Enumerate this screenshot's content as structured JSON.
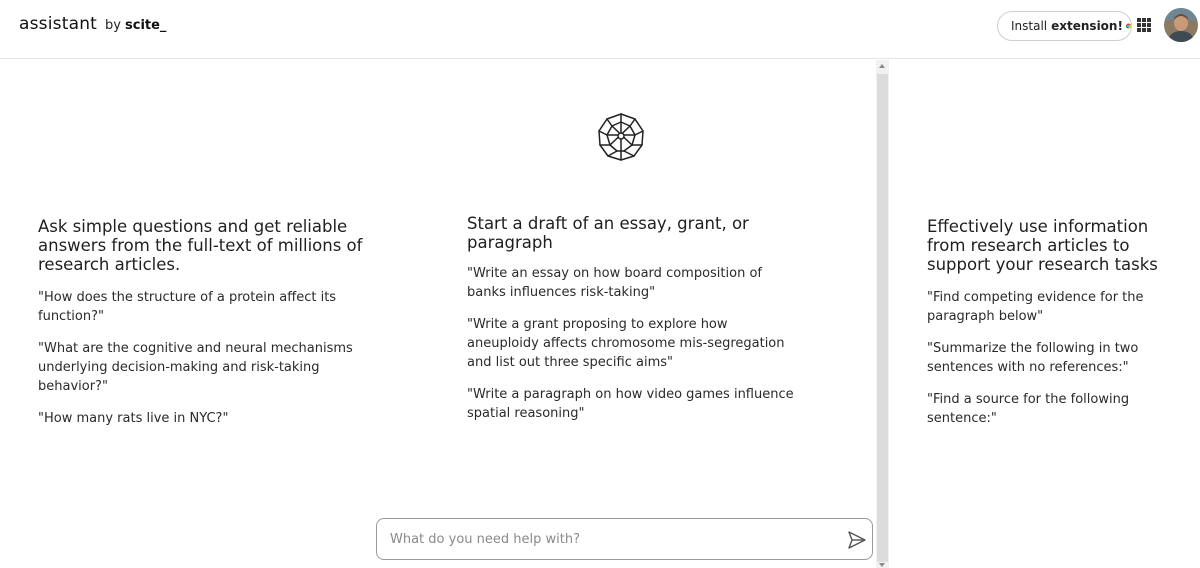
{
  "header": {
    "brand_name": "assistant",
    "brand_by": "by",
    "brand_org": "scite_",
    "install_text": "Install",
    "install_bold": "extension!",
    "chrome_icon": "chrome-icon",
    "apps_icon": "apps-grid-icon",
    "avatar_icon": "user-avatar"
  },
  "logo_icon": "brain-network-icon",
  "columns": [
    {
      "heading": "Ask simple questions and get reliable answers from the full-text of millions of research articles.",
      "examples": [
        "\"How does the structure of a protein affect its function?\"",
        "\"What are the cognitive and neural mechanisms underlying decision-making and risk-taking behavior?\"",
        "\"How many rats live in NYC?\""
      ]
    },
    {
      "heading": "Start a draft of an essay, grant, or paragraph",
      "examples": [
        "\"Write an essay on how board composition of banks influences risk-taking\"",
        "\"Write a grant proposing to explore how aneuploidy affects chromosome mis-segregation and list out three specific aims\"",
        "\"Write a paragraph on how video games influence spatial reasoning\""
      ]
    },
    {
      "heading": "Effectively use information from research articles to support your research tasks",
      "examples": [
        "\"Find competing evidence for the paragraph below\"",
        "\"Summarize the following in two sentences with no references:\"",
        "\"Find a source for the following sentence:\""
      ]
    }
  ],
  "prompt": {
    "placeholder": "What do you need help with?",
    "value": "",
    "send_icon": "send-icon"
  },
  "colors": {
    "text": "#1f1f1f",
    "border": "#cfcfcf",
    "background": "#ffffff"
  }
}
